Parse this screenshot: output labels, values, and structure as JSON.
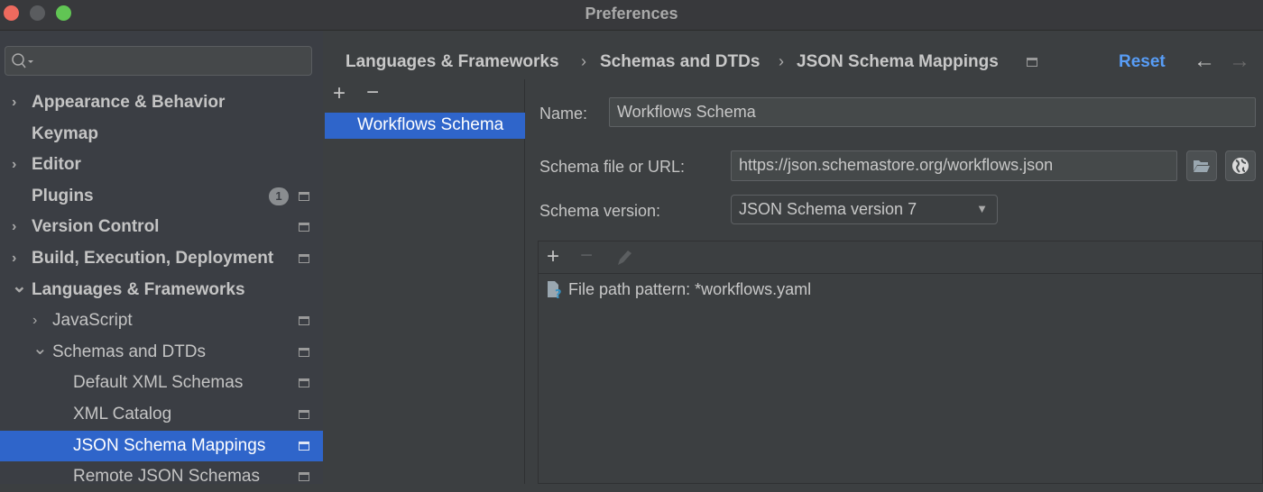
{
  "window": {
    "title": "Preferences"
  },
  "search": {
    "placeholder": ""
  },
  "sidebar": {
    "items": [
      {
        "label": "Appearance & Behavior",
        "expandable": true,
        "expanded": false
      },
      {
        "label": "Keymap"
      },
      {
        "label": "Editor",
        "expandable": true,
        "expanded": false
      },
      {
        "label": "Plugins",
        "badge": "1"
      },
      {
        "label": "Version Control",
        "expandable": true,
        "expanded": false
      },
      {
        "label": "Build, Execution, Deployment",
        "expandable": true,
        "expanded": false
      },
      {
        "label": "Languages & Frameworks",
        "expandable": true,
        "expanded": true
      },
      {
        "label": "JavaScript",
        "expandable": true,
        "expanded": false
      },
      {
        "label": "Schemas and DTDs",
        "expandable": true,
        "expanded": true
      },
      {
        "label": "Default XML Schemas"
      },
      {
        "label": "XML Catalog"
      },
      {
        "label": "JSON Schema Mappings",
        "selected": true
      },
      {
        "label": "Remote JSON Schemas"
      }
    ]
  },
  "breadcrumb": [
    "Languages & Frameworks",
    "Schemas and DTDs",
    "JSON Schema Mappings"
  ],
  "header": {
    "reset": "Reset"
  },
  "schemas": {
    "items": [
      "Workflows Schema"
    ]
  },
  "form": {
    "name_label": "Name:",
    "name_value": "Workflows Schema",
    "url_label": "Schema file or URL:",
    "url_value": "https://json.schemastore.org/workflows.json",
    "version_label": "Schema version:",
    "version_value": "JSON Schema version 7"
  },
  "mappings": [
    {
      "text": "File path pattern: *workflows.yaml"
    }
  ],
  "colors": {
    "accent": "#2f65ca",
    "link": "#589df6"
  }
}
